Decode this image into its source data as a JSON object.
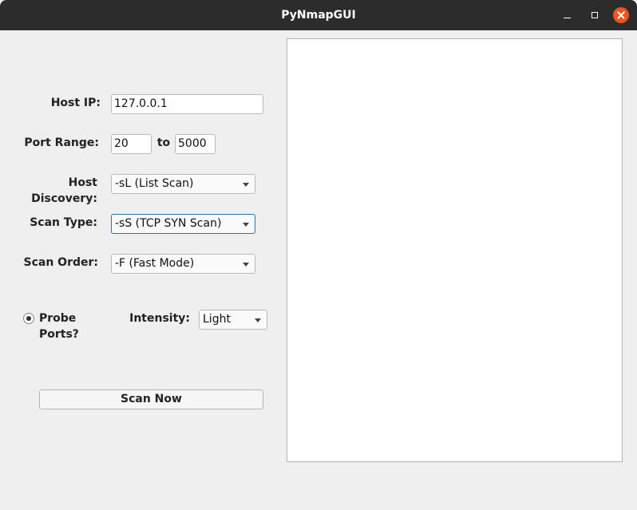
{
  "window": {
    "title": "PyNmapGUI"
  },
  "form": {
    "host_ip_label": "Host IP:",
    "host_ip_value": "127.0.0.1",
    "port_range_label": "Port Range:",
    "port_from": "20",
    "port_to_label": "to",
    "port_to": "5000",
    "host_discovery_label": "Host Discovery:",
    "host_discovery_value": "-sL (List Scan)",
    "scan_type_label": "Scan Type:",
    "scan_type_value": "-sS (TCP SYN Scan)",
    "scan_order_label": "Scan Order:",
    "scan_order_value": "-F (Fast Mode)",
    "probe_ports_label": "Probe Ports?",
    "probe_ports_checked": true,
    "intensity_label": "Intensity:",
    "intensity_value": "Light",
    "scan_button_label": "Scan Now"
  },
  "output": {
    "text": ""
  },
  "colors": {
    "titlebar": "#2c2c2c",
    "close_button": "#e95420",
    "background": "#efefef",
    "focus_border": "#3071a8"
  },
  "icons": [
    "minimize-icon",
    "maximize-icon",
    "close-icon",
    "dropdown-caret-icon",
    "radio-dot-icon"
  ]
}
